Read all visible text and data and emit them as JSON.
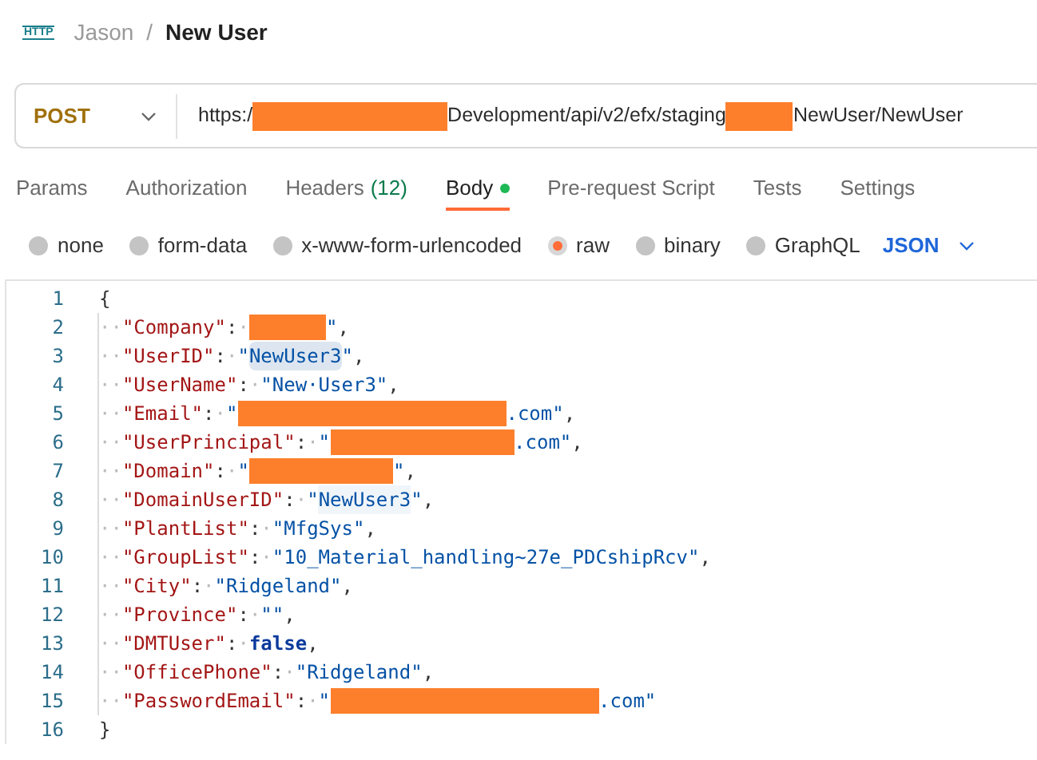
{
  "breadcrumb": {
    "icon_text": "HTTP",
    "parent": "Jason",
    "separator": "/",
    "current": "New User"
  },
  "request": {
    "method": "POST",
    "url_parts": [
      {
        "kind": "text",
        "text": "https:/"
      },
      {
        "kind": "redaction_wide"
      },
      {
        "kind": "text",
        "text": "Development/api/v2/efx/staging"
      },
      {
        "kind": "redaction_narrow"
      },
      {
        "kind": "text",
        "text": "NewUser/NewUser"
      }
    ]
  },
  "tabs": [
    {
      "label": "Params",
      "selected": false
    },
    {
      "label": "Authorization",
      "selected": false
    },
    {
      "label": "Headers",
      "count": "(12)",
      "selected": false
    },
    {
      "label": "Body",
      "dot": true,
      "selected": true
    },
    {
      "label": "Pre-request Script",
      "selected": false
    },
    {
      "label": "Tests",
      "selected": false
    },
    {
      "label": "Settings",
      "selected": false
    }
  ],
  "body_types": [
    {
      "label": "none",
      "selected": false
    },
    {
      "label": "form-data",
      "selected": false
    },
    {
      "label": "x-www-form-urlencoded",
      "selected": false
    },
    {
      "label": "raw",
      "selected": true
    },
    {
      "label": "binary",
      "selected": false
    },
    {
      "label": "GraphQL",
      "selected": false
    }
  ],
  "format": "JSON",
  "code_lines": [
    {
      "number": "1",
      "tokens": [
        {
          "kind": "punct",
          "text": "{"
        }
      ]
    },
    {
      "number": "2",
      "tokens": [
        {
          "kind": "ws",
          "text": "··"
        },
        {
          "kind": "key",
          "text": "\"Company\""
        },
        {
          "kind": "punct",
          "text": ":"
        },
        {
          "kind": "ws",
          "text": "·"
        },
        {
          "kind": "redaction_short"
        },
        {
          "kind": "string",
          "text": "\""
        },
        {
          "kind": "punct",
          "text": ","
        }
      ]
    },
    {
      "number": "3",
      "tokens": [
        {
          "kind": "ws",
          "text": "··"
        },
        {
          "kind": "key",
          "text": "\"UserID\""
        },
        {
          "kind": "punct",
          "text": ":"
        },
        {
          "kind": "ws",
          "text": "·"
        },
        {
          "kind": "string",
          "text": "\""
        },
        {
          "kind": "string",
          "text": "NewUser3",
          "selected": true
        },
        {
          "kind": "string",
          "text": "\""
        },
        {
          "kind": "punct",
          "text": ","
        }
      ]
    },
    {
      "number": "4",
      "tokens": [
        {
          "kind": "ws",
          "text": "··"
        },
        {
          "kind": "key",
          "text": "\"UserName\""
        },
        {
          "kind": "punct",
          "text": ":"
        },
        {
          "kind": "ws",
          "text": "·"
        },
        {
          "kind": "string",
          "text": "\"New·User3\""
        },
        {
          "kind": "punct",
          "text": ","
        }
      ]
    },
    {
      "number": "5",
      "tokens": [
        {
          "kind": "ws",
          "text": "··"
        },
        {
          "kind": "key",
          "text": "\"Email\""
        },
        {
          "kind": "punct",
          "text": ":"
        },
        {
          "kind": "ws",
          "text": "·"
        },
        {
          "kind": "string",
          "text": "\""
        },
        {
          "kind": "redaction_long"
        },
        {
          "kind": "string",
          "text": ".com\""
        },
        {
          "kind": "punct",
          "text": ","
        }
      ]
    },
    {
      "number": "6",
      "tokens": [
        {
          "kind": "ws",
          "text": "··"
        },
        {
          "kind": "key",
          "text": "\"UserPrincipal\""
        },
        {
          "kind": "punct",
          "text": ":"
        },
        {
          "kind": "ws",
          "text": "·"
        },
        {
          "kind": "string",
          "text": "\""
        },
        {
          "kind": "redaction_medium"
        },
        {
          "kind": "string",
          "text": ".com\""
        },
        {
          "kind": "punct",
          "text": ","
        }
      ]
    },
    {
      "number": "7",
      "tokens": [
        {
          "kind": "ws",
          "text": "··"
        },
        {
          "kind": "key",
          "text": "\"Domain\""
        },
        {
          "kind": "punct",
          "text": ":"
        },
        {
          "kind": "ws",
          "text": "·"
        },
        {
          "kind": "string",
          "text": "\""
        },
        {
          "kind": "redaction_domain"
        },
        {
          "kind": "string",
          "text": "\""
        },
        {
          "kind": "punct",
          "text": ","
        }
      ]
    },
    {
      "number": "8",
      "tokens": [
        {
          "kind": "ws",
          "text": "··"
        },
        {
          "kind": "key",
          "text": "\"DomainUserID\""
        },
        {
          "kind": "punct",
          "text": ":"
        },
        {
          "kind": "ws",
          "text": "·"
        },
        {
          "kind": "string",
          "text": "\""
        },
        {
          "kind": "string",
          "text": "NewUser3",
          "selected": false,
          "match": true
        },
        {
          "kind": "string",
          "text": "\""
        },
        {
          "kind": "punct",
          "text": ","
        }
      ]
    },
    {
      "number": "9",
      "tokens": [
        {
          "kind": "ws",
          "text": "··"
        },
        {
          "kind": "key",
          "text": "\"PlantList\""
        },
        {
          "kind": "punct",
          "text": ":"
        },
        {
          "kind": "ws",
          "text": "·"
        },
        {
          "kind": "string",
          "text": "\"MfgSys\""
        },
        {
          "kind": "punct",
          "text": ","
        }
      ]
    },
    {
      "number": "10",
      "tokens": [
        {
          "kind": "ws",
          "text": "··"
        },
        {
          "kind": "key",
          "text": "\"GroupList\""
        },
        {
          "kind": "punct",
          "text": ":"
        },
        {
          "kind": "ws",
          "text": "·"
        },
        {
          "kind": "string",
          "text": "\"10_Material_handling~27e_PDCshipRcv\""
        },
        {
          "kind": "punct",
          "text": ","
        }
      ]
    },
    {
      "number": "11",
      "tokens": [
        {
          "kind": "ws",
          "text": "··"
        },
        {
          "kind": "key",
          "text": "\"City\""
        },
        {
          "kind": "punct",
          "text": ":"
        },
        {
          "kind": "ws",
          "text": "·"
        },
        {
          "kind": "string",
          "text": "\"Ridgeland\""
        },
        {
          "kind": "punct",
          "text": ","
        }
      ]
    },
    {
      "number": "12",
      "tokens": [
        {
          "kind": "ws",
          "text": "··"
        },
        {
          "kind": "key",
          "text": "\"Province\""
        },
        {
          "kind": "punct",
          "text": ":"
        },
        {
          "kind": "ws",
          "text": "·"
        },
        {
          "kind": "string",
          "text": "\"\""
        },
        {
          "kind": "punct",
          "text": ","
        }
      ]
    },
    {
      "number": "13",
      "tokens": [
        {
          "kind": "ws",
          "text": "··"
        },
        {
          "kind": "key",
          "text": "\"DMTUser\""
        },
        {
          "kind": "punct",
          "text": ":"
        },
        {
          "kind": "ws",
          "text": "·"
        },
        {
          "kind": "keyword",
          "text": "false"
        },
        {
          "kind": "punct",
          "text": ","
        }
      ]
    },
    {
      "number": "14",
      "tokens": [
        {
          "kind": "ws",
          "text": "··"
        },
        {
          "kind": "key",
          "text": "\"OfficePhone\""
        },
        {
          "kind": "punct",
          "text": ":"
        },
        {
          "kind": "ws",
          "text": "·"
        },
        {
          "kind": "string",
          "text": "\"Ridgeland\""
        },
        {
          "kind": "punct",
          "text": ","
        }
      ]
    },
    {
      "number": "15",
      "tokens": [
        {
          "kind": "ws",
          "text": "··"
        },
        {
          "kind": "key",
          "text": "\"PasswordEmail\""
        },
        {
          "kind": "punct",
          "text": ":"
        },
        {
          "kind": "ws",
          "text": "·"
        },
        {
          "kind": "string",
          "text": "\""
        },
        {
          "kind": "redaction_long"
        },
        {
          "kind": "string",
          "text": ".com\""
        }
      ]
    },
    {
      "number": "16",
      "tokens": [
        {
          "kind": "punct",
          "text": "}"
        }
      ]
    }
  ]
}
